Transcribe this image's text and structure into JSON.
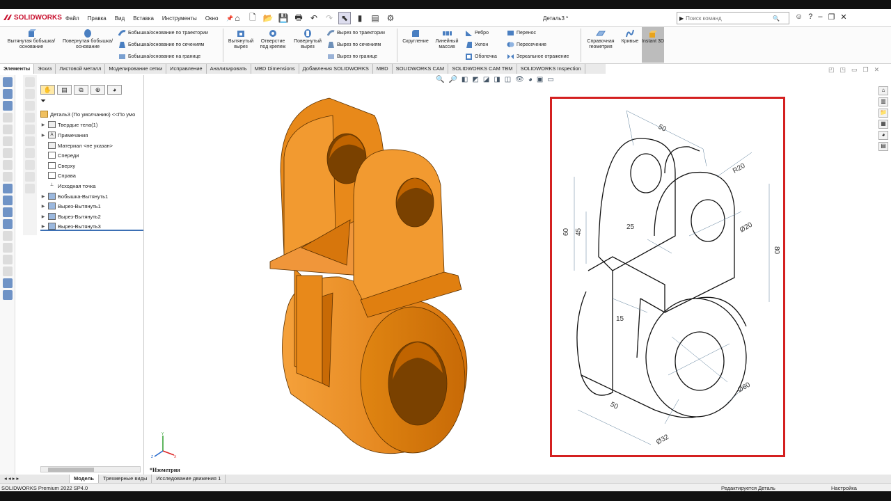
{
  "app": {
    "brand": "SOLIDWORKS",
    "document_title": "Деталь3 *"
  },
  "menu": [
    "Файл",
    "Правка",
    "Вид",
    "Вставка",
    "Инструменты",
    "Окно"
  ],
  "search": {
    "placeholder": "Поиск команд"
  },
  "ribbon": {
    "extruded_boss": "Вытянутая бобышка/основание",
    "revolved_boss": "Повернутая бобышка/основание",
    "swept_boss": "Бобышка/основание по траектории",
    "lofted_boss": "Бобышка/основание по сечениям",
    "boundary_boss": "Бобышка/основание на границе",
    "extruded_cut": "Вытянутый вырез",
    "hole_wizard": "Отверстие под крепеж",
    "revolved_cut": "Повернутый вырез",
    "swept_cut": "Вырез по траектории",
    "lofted_cut": "Вырез по сечениям",
    "boundary_cut": "Вырез по границе",
    "fillet": "Скругление",
    "linear_pattern": "Линейный массив",
    "rib": "Ребро",
    "draft": "Уклон",
    "shell": "Оболочка",
    "wrap": "Перенос",
    "intersect": "Пересечение",
    "mirror": "Зеркальное отражение",
    "ref_geometry": "Справочная геометрия",
    "curves": "Кривые",
    "instant3d": "Instant 3D"
  },
  "tabs": [
    "Элементы",
    "Эскиз",
    "Листовой металл",
    "Моделирование сетки",
    "Исправление",
    "Анализировать",
    "MBD Dimensions",
    "Добавления SOLIDWORKS",
    "MBD",
    "SOLIDWORKS CAM",
    "SOLIDWORKS CAM TBM",
    "SOLIDWORKS Inspection"
  ],
  "tree": {
    "root": "Деталь3 (По умолчанию) <<По умо",
    "items": [
      "Твердые тела(1)",
      "Примечания",
      "Материал <не указан>",
      "Спереди",
      "Сверху",
      "Справа",
      "Исходная точка",
      "Бобышка-Вытянуть1",
      "Вырез-Вытянуть1",
      "Вырез-Вытянуть2",
      "Вырез-Вытянуть3"
    ]
  },
  "view": {
    "orientation_label": "*Изометрия"
  },
  "drawing": {
    "dims": [
      "50",
      "60",
      "45",
      "25",
      "R20",
      "Ø20",
      "80",
      "15",
      "50",
      "Ø60",
      "Ø32"
    ]
  },
  "bottom_tabs": [
    "Модель",
    "Трехмерные виды",
    "Исследование движения 1"
  ],
  "status": {
    "version": "SOLIDWORKS Premium 2022 SP4.0",
    "editing": "Редактируется Деталь",
    "custom": "Настройка"
  },
  "colors": {
    "part": "#e8820c",
    "part_dark": "#b35f00",
    "part_light": "#f4a040",
    "frame": "#d42020",
    "brand": "#c8102e"
  }
}
